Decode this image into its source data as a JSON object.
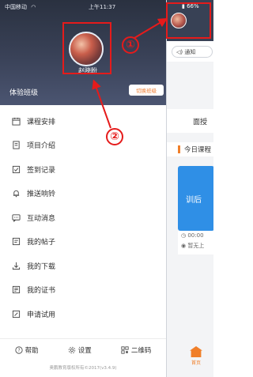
{
  "status": {
    "carrier": "中国移动",
    "wifi_icon": "wifi-icon",
    "time": "上午11:37",
    "battery": "66%"
  },
  "drawer": {
    "username": "赵晓盼",
    "class_label": "体验班级",
    "switch_label": "切换班级",
    "menu": [
      {
        "icon": "calendar-icon",
        "label": "课程安排"
      },
      {
        "icon": "document-icon",
        "label": "项目介绍"
      },
      {
        "icon": "checkbox-icon",
        "label": "签到记录"
      },
      {
        "icon": "bell-icon",
        "label": "推送响铃"
      },
      {
        "icon": "chat-icon",
        "label": "互动消息"
      },
      {
        "icon": "post-icon",
        "label": "我的帖子"
      },
      {
        "icon": "download-icon",
        "label": "我的下载"
      },
      {
        "icon": "certificate-icon",
        "label": "我的证书"
      },
      {
        "icon": "apply-icon",
        "label": "申请试用"
      }
    ],
    "footer": {
      "help": "帮助",
      "settings": "设置",
      "qrcode": "二维码",
      "copyright": "奥鹏教育版权所有©2017(v3.4.9)"
    }
  },
  "main": {
    "notice": "通知",
    "tab_face": "面授",
    "today_title": "今日课程",
    "card_title": "训后",
    "card_time": "00:00",
    "card_loc": "暂无上",
    "home_label": "首页"
  },
  "annotations": {
    "one": "①",
    "two": "②"
  },
  "colors": {
    "accent": "#f07f2a",
    "annotation": "#e51b1b",
    "header_bg": "#384155",
    "card_blue": "#2f8fe6"
  }
}
